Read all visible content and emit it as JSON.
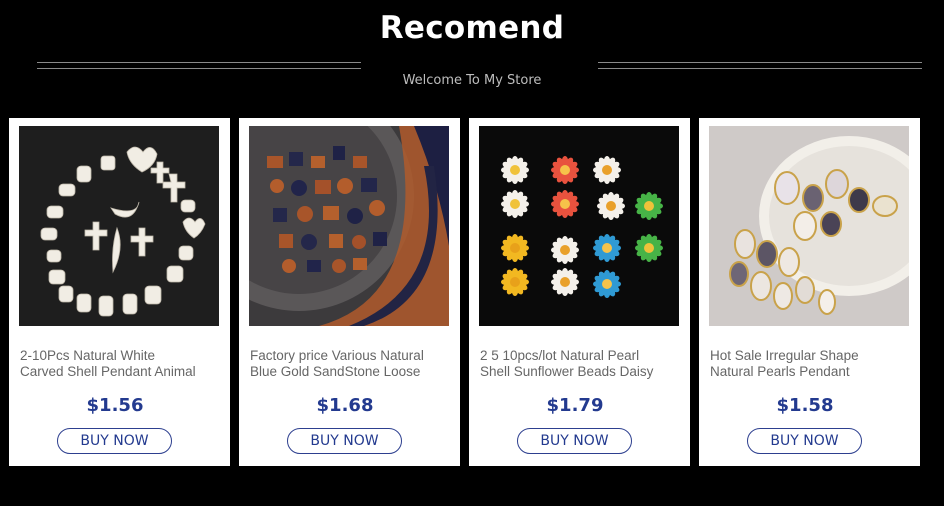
{
  "header": {
    "title": "Recomend",
    "subtitle": "Welcome To My Store"
  },
  "products": [
    {
      "name": "2-10Pcs Natural White\nCarved Shell Pendant Animal",
      "price": "$1.56",
      "button": "BUY NOW"
    },
    {
      "name": "Factory price Various Natural\nBlue Gold SandStone Loose",
      "price": "$1.68",
      "button": "BUY NOW"
    },
    {
      "name": "2 5 10pcs/lot Natural Pearl\nShell Sunflower Beads Daisy",
      "price": "$1.79",
      "button": "BUY NOW"
    },
    {
      "name": "Hot Sale Irregular Shape\nNatural Pearls Pendant",
      "price": "$1.58",
      "button": "BUY NOW"
    }
  ],
  "colors": {
    "background": "#000000",
    "price": "#233a8f",
    "button_border": "#2d3f8f"
  }
}
